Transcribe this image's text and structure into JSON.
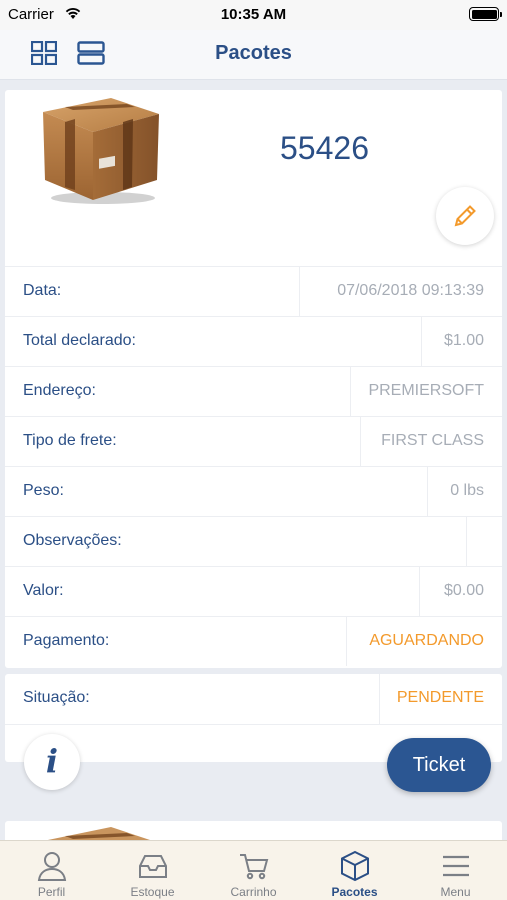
{
  "status_bar": {
    "carrier": "Carrier",
    "time": "10:35 AM"
  },
  "nav": {
    "title": "Pacotes"
  },
  "package": {
    "number": "55426",
    "rows": [
      {
        "label": "Data:",
        "value": "07/06/2018 09:13:39"
      },
      {
        "label": "Total declarado:",
        "value": "$1.00"
      },
      {
        "label": "Endereço:",
        "value": "PREMIERSOFT"
      },
      {
        "label": "Tipo de frete:",
        "value": "FIRST CLASS"
      },
      {
        "label": "Peso:",
        "value": "0 lbs"
      },
      {
        "label": "Observações:",
        "value": ""
      },
      {
        "label": "Valor:",
        "value": "$0.00"
      },
      {
        "label": "Pagamento:",
        "value": "AGUARDANDO"
      }
    ],
    "status": {
      "label": "Situação:",
      "value": "PENDENTE"
    }
  },
  "actions": {
    "info": "i",
    "ticket": "Ticket"
  },
  "tabs": [
    {
      "label": "Perfil",
      "icon": "person-icon"
    },
    {
      "label": "Estoque",
      "icon": "inbox-icon"
    },
    {
      "label": "Carrinho",
      "icon": "cart-icon"
    },
    {
      "label": "Pacotes",
      "icon": "box-icon",
      "active": true
    },
    {
      "label": "Menu",
      "icon": "menu-icon"
    }
  ],
  "colors": {
    "primary": "#2b4f86",
    "accent_orange": "#f39a2c",
    "muted": "#a7adb6",
    "ticket_button": "#2b5692"
  }
}
